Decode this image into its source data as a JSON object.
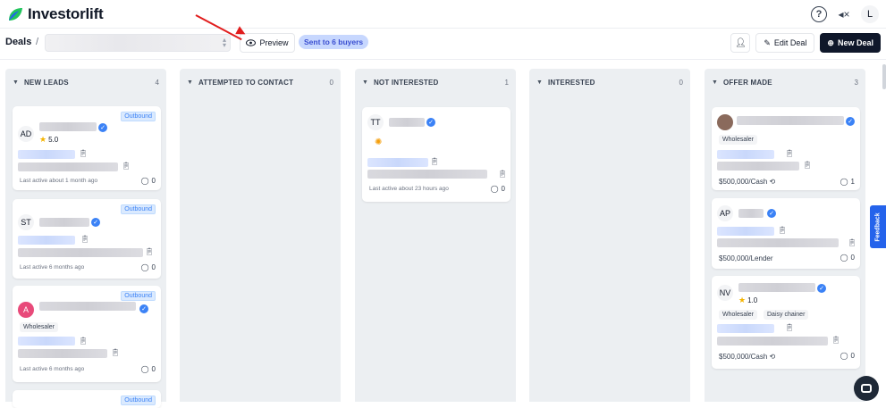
{
  "app": {
    "name": "Investorlift"
  },
  "topbar": {
    "help_icon": "help-circle-icon",
    "mute_icon": "speaker-mute-icon",
    "avatar_initial": "L"
  },
  "subbar": {
    "breadcrumb": "Deals",
    "separator": "/",
    "preview_label": "Preview",
    "sent_badge": "Sent to 6 buyers",
    "edit_label": "Edit Deal",
    "new_label": "New Deal"
  },
  "columns": [
    {
      "title": "NEW LEADS",
      "count": "4"
    },
    {
      "title": "ATTEMPTED TO CONTACT",
      "count": "0"
    },
    {
      "title": "NOT INTERESTED",
      "count": "1"
    },
    {
      "title": "INTERESTED",
      "count": "0"
    },
    {
      "title": "OFFER MADE",
      "count": "3"
    }
  ],
  "new_leads": [
    {
      "initials": "AD",
      "tag": "Outbound",
      "rating": "5.0",
      "last_active": "Last active about 1 month ago",
      "comments": "0"
    },
    {
      "initials": "ST",
      "tag": "Outbound",
      "last_active": "Last active 6 months ago",
      "comments": "0"
    },
    {
      "initials": "A",
      "tag": "Outbound",
      "chip": "Wholesaler",
      "last_active": "Last active 6 months ago",
      "comments": "0"
    },
    {
      "tag": "Outbound"
    }
  ],
  "not_interested": [
    {
      "initials": "TT",
      "last_active": "Last active about 23 hours ago",
      "comments": "0"
    }
  ],
  "offer_made": [
    {
      "chip": "Wholesaler",
      "price": "$500,000/Cash",
      "comments": "1"
    },
    {
      "initials": "AP",
      "price": "$500,000/Lender",
      "comments": "0"
    },
    {
      "initials": "NV",
      "rating": "1.0",
      "chips": [
        "Wholesaler",
        "Daisy chainer"
      ],
      "price": "$500,000/Cash",
      "comments": "0"
    }
  ],
  "feedback_label": "Feedback"
}
